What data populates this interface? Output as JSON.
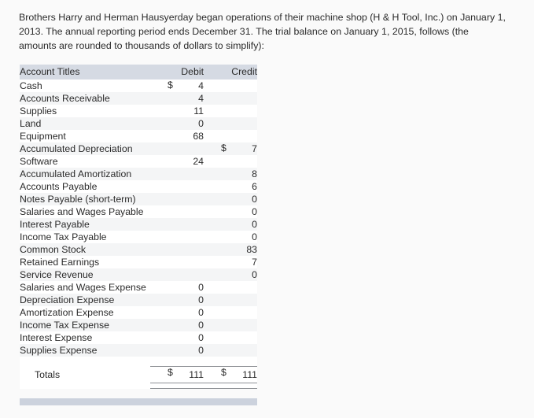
{
  "intro": {
    "paragraph": "Brothers Harry and Herman Hausyerday began operations of their machine shop (H & H Tool, Inc.) on January 1, 2013. The annual reporting period ends December 31. The trial balance on January 1, 2015, follows (the amounts are rounded to thousands of dollars to simplify):"
  },
  "table": {
    "headers": {
      "account": "Account Titles",
      "debit": "Debit",
      "credit": "Credit"
    },
    "currency_symbol": "$",
    "rows": [
      {
        "account": "Cash",
        "debit": "4",
        "credit": "",
        "debit_cur": "$",
        "credit_cur": ""
      },
      {
        "account": "Accounts Receivable",
        "debit": "4",
        "credit": "",
        "debit_cur": "",
        "credit_cur": ""
      },
      {
        "account": "Supplies",
        "debit": "11",
        "credit": "",
        "debit_cur": "",
        "credit_cur": ""
      },
      {
        "account": "Land",
        "debit": "0",
        "credit": "",
        "debit_cur": "",
        "credit_cur": ""
      },
      {
        "account": "Equipment",
        "debit": "68",
        "credit": "",
        "debit_cur": "",
        "credit_cur": ""
      },
      {
        "account": "Accumulated Depreciation",
        "debit": "",
        "credit": "7",
        "debit_cur": "",
        "credit_cur": "$"
      },
      {
        "account": "Software",
        "debit": "24",
        "credit": "",
        "debit_cur": "",
        "credit_cur": ""
      },
      {
        "account": "Accumulated Amortization",
        "debit": "",
        "credit": "8",
        "debit_cur": "",
        "credit_cur": ""
      },
      {
        "account": "Accounts Payable",
        "debit": "",
        "credit": "6",
        "debit_cur": "",
        "credit_cur": ""
      },
      {
        "account": "Notes Payable (short-term)",
        "debit": "",
        "credit": "0",
        "debit_cur": "",
        "credit_cur": ""
      },
      {
        "account": "Salaries and Wages Payable",
        "debit": "",
        "credit": "0",
        "debit_cur": "",
        "credit_cur": ""
      },
      {
        "account": "Interest Payable",
        "debit": "",
        "credit": "0",
        "debit_cur": "",
        "credit_cur": ""
      },
      {
        "account": "Income Tax Payable",
        "debit": "",
        "credit": "0",
        "debit_cur": "",
        "credit_cur": ""
      },
      {
        "account": "Common Stock",
        "debit": "",
        "credit": "83",
        "debit_cur": "",
        "credit_cur": ""
      },
      {
        "account": "Retained Earnings",
        "debit": "",
        "credit": "7",
        "debit_cur": "",
        "credit_cur": ""
      },
      {
        "account": "Service Revenue",
        "debit": "",
        "credit": "0",
        "debit_cur": "",
        "credit_cur": ""
      },
      {
        "account": "Salaries and Wages Expense",
        "debit": "0",
        "credit": "",
        "debit_cur": "",
        "credit_cur": ""
      },
      {
        "account": "Depreciation Expense",
        "debit": "0",
        "credit": "",
        "debit_cur": "",
        "credit_cur": ""
      },
      {
        "account": "Amortization Expense",
        "debit": "0",
        "credit": "",
        "debit_cur": "",
        "credit_cur": ""
      },
      {
        "account": "Income Tax Expense",
        "debit": "0",
        "credit": "",
        "debit_cur": "",
        "credit_cur": ""
      },
      {
        "account": "Interest Expense",
        "debit": "0",
        "credit": "",
        "debit_cur": "",
        "credit_cur": ""
      },
      {
        "account": "Supplies Expense",
        "debit": "0",
        "credit": "",
        "debit_cur": "",
        "credit_cur": ""
      }
    ],
    "totals": {
      "label": "Totals",
      "debit": "111",
      "credit": "111",
      "debit_cur": "$",
      "credit_cur": "$"
    }
  },
  "colors": {
    "page_background": "#fafafa",
    "header_bar": "#d5dae3",
    "row_stripe": "#f4f5f6",
    "text": "#2b2b2b",
    "rule": "#8f9296",
    "bottom_divider": "#ccd2dd"
  }
}
